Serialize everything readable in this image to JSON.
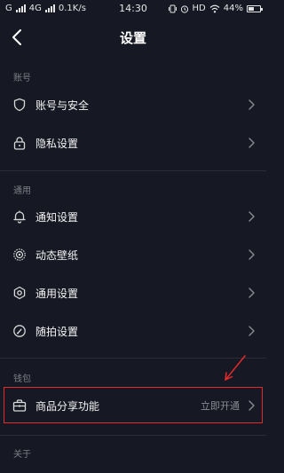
{
  "status_bar": {
    "network_left": "G",
    "network_type": "4G",
    "speed": "0.1K/s",
    "time": "14:30",
    "hd": "HD",
    "battery": "44%"
  },
  "header": {
    "title": "设置",
    "back_icon": "chevron-left-icon"
  },
  "sections": [
    {
      "label": "账号",
      "items": [
        {
          "label": "账号与安全",
          "icon": "shield-icon"
        },
        {
          "label": "隐私设置",
          "icon": "lock-icon"
        }
      ]
    },
    {
      "label": "通用",
      "items": [
        {
          "label": "通知设置",
          "icon": "bell-icon"
        },
        {
          "label": "动态壁纸",
          "icon": "wallpaper-icon"
        },
        {
          "label": "通用设置",
          "icon": "gear-icon"
        },
        {
          "label": "随拍设置",
          "icon": "camera-dial-icon"
        }
      ]
    },
    {
      "label": "钱包",
      "items": [
        {
          "label": "商品分享功能",
          "icon": "briefcase-icon",
          "value": "立即开通"
        }
      ]
    },
    {
      "label": "关于",
      "items": []
    }
  ],
  "colors": {
    "background": "#161823",
    "highlight": "#e32b2b"
  }
}
